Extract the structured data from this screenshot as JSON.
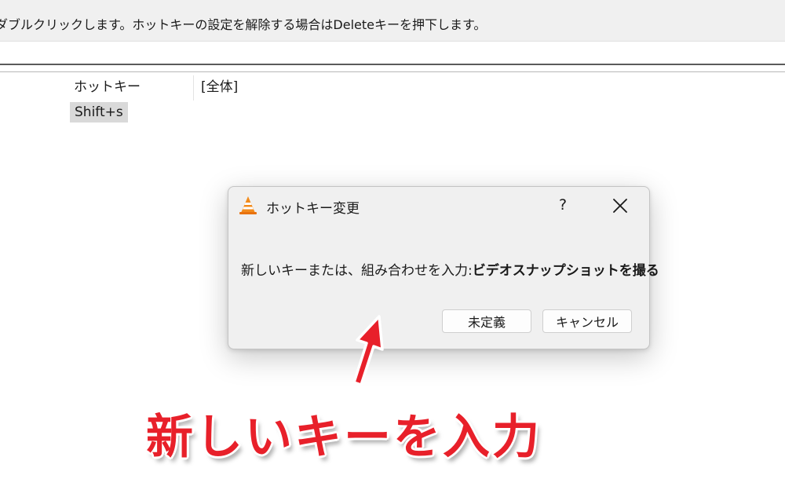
{
  "hint": {
    "text": "ダブルクリックします。ホットキーの設定を解除する場合はDeleteキーを押下します。"
  },
  "search": {
    "value": ""
  },
  "table": {
    "headers": [
      "ホットキー",
      "[全体]"
    ],
    "rows": [
      {
        "hotkey": "Shift+s",
        "global": ""
      }
    ]
  },
  "dialog": {
    "icon": "vlc-cone-icon",
    "title": "ホットキー変更",
    "help_label": "?",
    "close_icon": "close-icon",
    "message_prefix": "新しいキーまたは、組み合わせを入力:",
    "message_action": "ビデオスナップショットを撮る",
    "buttons": {
      "undefined_label": "未定義",
      "cancel_label": "キャンセル"
    }
  },
  "annotation": {
    "caption": "新しいキーを入力",
    "arrow_icon": "red-arrow-icon",
    "color": "#e8202a"
  }
}
